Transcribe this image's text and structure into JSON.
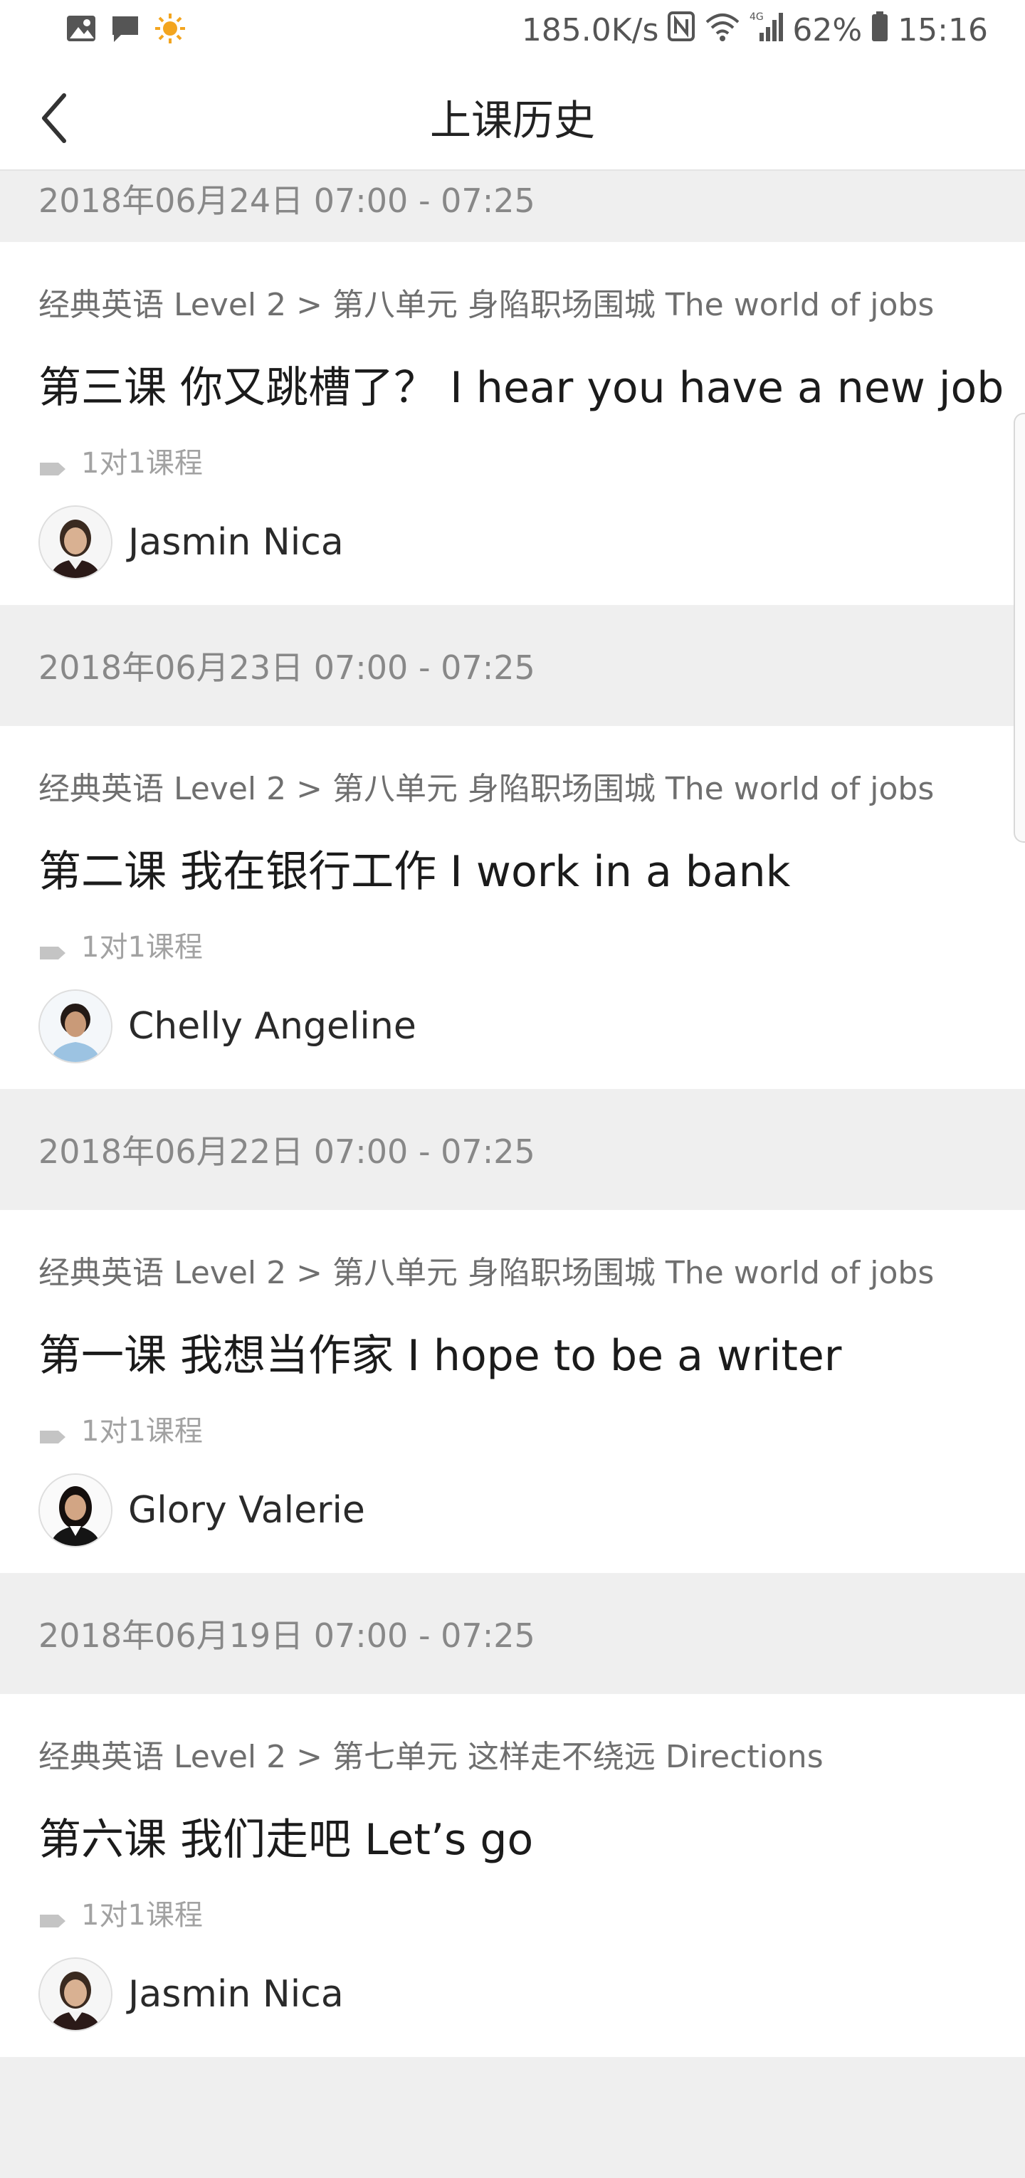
{
  "status_bar": {
    "speed": "185.0K/s",
    "network": "4G",
    "battery": "62%",
    "time": "15:16"
  },
  "header": {
    "title": "上课历史"
  },
  "lessons": [
    {
      "date": "2018年06月24日 07:00 - 07:25",
      "course": "经典英语 Level 2 > 第八单元 身陷职场围城 The world of jobs",
      "title": "第三课 你又跳槽了？ I hear you have a new job",
      "tag": "1对1课程",
      "teacher": "Jasmin Nica"
    },
    {
      "date": "2018年06月23日 07:00 - 07:25",
      "course": "经典英语 Level 2 > 第八单元 身陷职场围城 The world of jobs",
      "title": "第二课 我在银行工作 I work in a bank",
      "tag": "1对1课程",
      "teacher": "Chelly Angeline"
    },
    {
      "date": "2018年06月22日 07:00 - 07:25",
      "course": "经典英语 Level 2 > 第八单元 身陷职场围城 The world of jobs",
      "title": "第一课 我想当作家 I hope to be a writer",
      "tag": "1对1课程",
      "teacher": "Glory Valerie"
    },
    {
      "date": "2018年06月19日 07:00 - 07:25",
      "course": "经典英语 Level 2 > 第七单元 这样走不绕远 Directions",
      "title": "第六课 我们走吧 Let’s go",
      "tag": "1对1课程",
      "teacher": "Jasmin Nica"
    }
  ]
}
